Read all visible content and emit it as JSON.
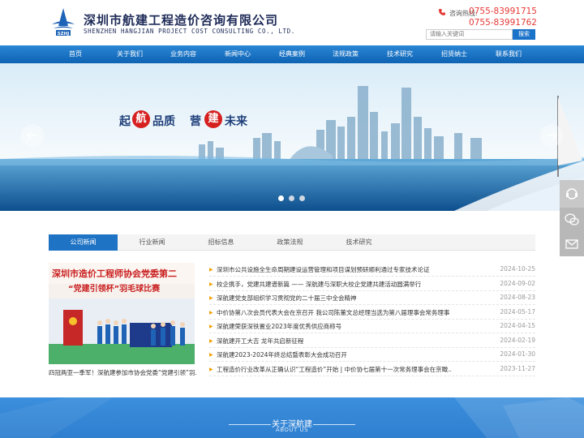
{
  "header": {
    "logo_text": "SZHJ",
    "company_cn": "深圳市航建工程造价咨询有限公司",
    "company_en": "SHENZHEN HANGJIAN PROJECT COST CONSULTING CO., LTD.",
    "hotline_label": "咨询热线:",
    "phone1": "0755-83991715",
    "phone2": "0755-83991762",
    "search_placeholder": "请输入关键词",
    "search_button": "搜索"
  },
  "nav": {
    "items": [
      "首页",
      "关于我们",
      "业务内容",
      "新闻中心",
      "经典案例",
      "法规政策",
      "技术研究",
      "招贤纳士",
      "联系我们"
    ]
  },
  "banner": {
    "slogan_left_a": "起",
    "slogan_left_circle": "航",
    "slogan_left_b": "品质",
    "slogan_right_a": "营",
    "slogan_right_circle": "建",
    "slogan_right_b": "未来",
    "slides_total": 3,
    "active_slide": 1
  },
  "tabs": [
    "公司新闻",
    "行业新闻",
    "招标信息",
    "政策法规",
    "技术研究"
  ],
  "news": {
    "image_heading": "深圳市造价工程师协会党委第二",
    "image_subheading": "“党建引领杯”羽毛球比赛",
    "caption": "四冠两亚一季军！深航建参加市协会党委“党建引领”羽...",
    "items": [
      {
        "title": "深圳市公共设施全生命周期建设运营管理和项目谋划预研顺利通过专家技术论证",
        "date": "2024-10-25"
      },
      {
        "title": "校企携手，党建共建谱新篇 —— 深航建与深职大校企党建共建活动圆满举行",
        "date": "2024-09-02"
      },
      {
        "title": "深航建党支部组织学习贯彻党的二十届三中全会精神",
        "date": "2024-08-23"
      },
      {
        "title": "中价协第八次会员代表大会在京召开 我公司陈董文总经理当选为第八届理事会常务理事",
        "date": "2024-05-17"
      },
      {
        "title": "深航建荣获深铁置业2023年度优秀供应商称号",
        "date": "2024-04-15"
      },
      {
        "title": "深航建开工大吉 龙年共启新征程",
        "date": "2024-02-19"
      },
      {
        "title": "深航建2023-2024年终总结暨表彰大会成功召开",
        "date": "2024-01-30"
      },
      {
        "title": "工程造价行业改革从正确认识“工程造价”开始 | 中价协七届第十一次常务理事会在京瞰...",
        "date": "2023-11-27"
      }
    ]
  },
  "about": {
    "title": "关于深航建",
    "subtitle": "ABOUT US"
  }
}
